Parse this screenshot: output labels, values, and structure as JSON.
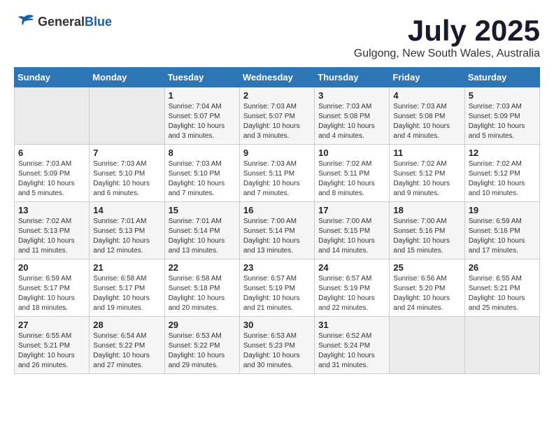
{
  "header": {
    "logo_general": "General",
    "logo_blue": "Blue",
    "month_title": "July 2025",
    "location": "Gulgong, New South Wales, Australia"
  },
  "calendar": {
    "days_of_week": [
      "Sunday",
      "Monday",
      "Tuesday",
      "Wednesday",
      "Thursday",
      "Friday",
      "Saturday"
    ],
    "weeks": [
      [
        {
          "day": "",
          "info": ""
        },
        {
          "day": "",
          "info": ""
        },
        {
          "day": "1",
          "info": "Sunrise: 7:04 AM\nSunset: 5:07 PM\nDaylight: 10 hours and 3 minutes."
        },
        {
          "day": "2",
          "info": "Sunrise: 7:03 AM\nSunset: 5:07 PM\nDaylight: 10 hours and 3 minutes."
        },
        {
          "day": "3",
          "info": "Sunrise: 7:03 AM\nSunset: 5:08 PM\nDaylight: 10 hours and 4 minutes."
        },
        {
          "day": "4",
          "info": "Sunrise: 7:03 AM\nSunset: 5:08 PM\nDaylight: 10 hours and 4 minutes."
        },
        {
          "day": "5",
          "info": "Sunrise: 7:03 AM\nSunset: 5:09 PM\nDaylight: 10 hours and 5 minutes."
        }
      ],
      [
        {
          "day": "6",
          "info": "Sunrise: 7:03 AM\nSunset: 5:09 PM\nDaylight: 10 hours and 5 minutes."
        },
        {
          "day": "7",
          "info": "Sunrise: 7:03 AM\nSunset: 5:10 PM\nDaylight: 10 hours and 6 minutes."
        },
        {
          "day": "8",
          "info": "Sunrise: 7:03 AM\nSunset: 5:10 PM\nDaylight: 10 hours and 7 minutes."
        },
        {
          "day": "9",
          "info": "Sunrise: 7:03 AM\nSunset: 5:11 PM\nDaylight: 10 hours and 7 minutes."
        },
        {
          "day": "10",
          "info": "Sunrise: 7:02 AM\nSunset: 5:11 PM\nDaylight: 10 hours and 8 minutes."
        },
        {
          "day": "11",
          "info": "Sunrise: 7:02 AM\nSunset: 5:12 PM\nDaylight: 10 hours and 9 minutes."
        },
        {
          "day": "12",
          "info": "Sunrise: 7:02 AM\nSunset: 5:12 PM\nDaylight: 10 hours and 10 minutes."
        }
      ],
      [
        {
          "day": "13",
          "info": "Sunrise: 7:02 AM\nSunset: 5:13 PM\nDaylight: 10 hours and 11 minutes."
        },
        {
          "day": "14",
          "info": "Sunrise: 7:01 AM\nSunset: 5:13 PM\nDaylight: 10 hours and 12 minutes."
        },
        {
          "day": "15",
          "info": "Sunrise: 7:01 AM\nSunset: 5:14 PM\nDaylight: 10 hours and 13 minutes."
        },
        {
          "day": "16",
          "info": "Sunrise: 7:00 AM\nSunset: 5:14 PM\nDaylight: 10 hours and 13 minutes."
        },
        {
          "day": "17",
          "info": "Sunrise: 7:00 AM\nSunset: 5:15 PM\nDaylight: 10 hours and 14 minutes."
        },
        {
          "day": "18",
          "info": "Sunrise: 7:00 AM\nSunset: 5:16 PM\nDaylight: 10 hours and 15 minutes."
        },
        {
          "day": "19",
          "info": "Sunrise: 6:59 AM\nSunset: 5:16 PM\nDaylight: 10 hours and 17 minutes."
        }
      ],
      [
        {
          "day": "20",
          "info": "Sunrise: 6:59 AM\nSunset: 5:17 PM\nDaylight: 10 hours and 18 minutes."
        },
        {
          "day": "21",
          "info": "Sunrise: 6:58 AM\nSunset: 5:17 PM\nDaylight: 10 hours and 19 minutes."
        },
        {
          "day": "22",
          "info": "Sunrise: 6:58 AM\nSunset: 5:18 PM\nDaylight: 10 hours and 20 minutes."
        },
        {
          "day": "23",
          "info": "Sunrise: 6:57 AM\nSunset: 5:19 PM\nDaylight: 10 hours and 21 minutes."
        },
        {
          "day": "24",
          "info": "Sunrise: 6:57 AM\nSunset: 5:19 PM\nDaylight: 10 hours and 22 minutes."
        },
        {
          "day": "25",
          "info": "Sunrise: 6:56 AM\nSunset: 5:20 PM\nDaylight: 10 hours and 24 minutes."
        },
        {
          "day": "26",
          "info": "Sunrise: 6:55 AM\nSunset: 5:21 PM\nDaylight: 10 hours and 25 minutes."
        }
      ],
      [
        {
          "day": "27",
          "info": "Sunrise: 6:55 AM\nSunset: 5:21 PM\nDaylight: 10 hours and 26 minutes."
        },
        {
          "day": "28",
          "info": "Sunrise: 6:54 AM\nSunset: 5:22 PM\nDaylight: 10 hours and 27 minutes."
        },
        {
          "day": "29",
          "info": "Sunrise: 6:53 AM\nSunset: 5:22 PM\nDaylight: 10 hours and 29 minutes."
        },
        {
          "day": "30",
          "info": "Sunrise: 6:53 AM\nSunset: 5:23 PM\nDaylight: 10 hours and 30 minutes."
        },
        {
          "day": "31",
          "info": "Sunrise: 6:52 AM\nSunset: 5:24 PM\nDaylight: 10 hours and 31 minutes."
        },
        {
          "day": "",
          "info": ""
        },
        {
          "day": "",
          "info": ""
        }
      ]
    ]
  }
}
